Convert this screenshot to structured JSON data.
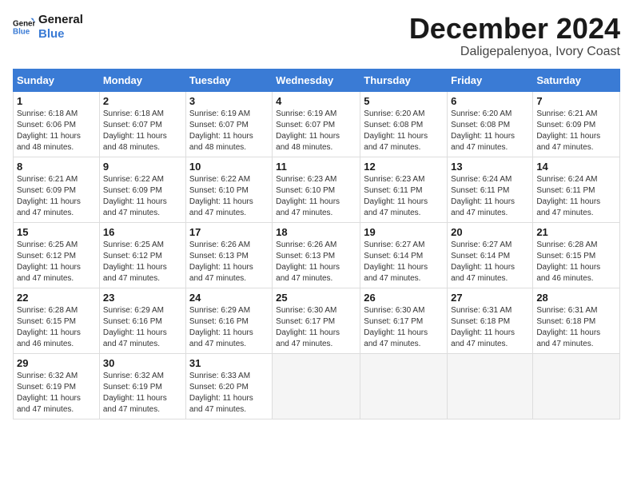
{
  "logo": {
    "line1": "General",
    "line2": "Blue"
  },
  "title": "December 2024",
  "location": "Daligepalenyoa, Ivory Coast",
  "headers": [
    "Sunday",
    "Monday",
    "Tuesday",
    "Wednesday",
    "Thursday",
    "Friday",
    "Saturday"
  ],
  "weeks": [
    [
      {
        "day": "1",
        "detail": "Sunrise: 6:18 AM\nSunset: 6:06 PM\nDaylight: 11 hours\nand 48 minutes."
      },
      {
        "day": "2",
        "detail": "Sunrise: 6:18 AM\nSunset: 6:07 PM\nDaylight: 11 hours\nand 48 minutes."
      },
      {
        "day": "3",
        "detail": "Sunrise: 6:19 AM\nSunset: 6:07 PM\nDaylight: 11 hours\nand 48 minutes."
      },
      {
        "day": "4",
        "detail": "Sunrise: 6:19 AM\nSunset: 6:07 PM\nDaylight: 11 hours\nand 48 minutes."
      },
      {
        "day": "5",
        "detail": "Sunrise: 6:20 AM\nSunset: 6:08 PM\nDaylight: 11 hours\nand 47 minutes."
      },
      {
        "day": "6",
        "detail": "Sunrise: 6:20 AM\nSunset: 6:08 PM\nDaylight: 11 hours\nand 47 minutes."
      },
      {
        "day": "7",
        "detail": "Sunrise: 6:21 AM\nSunset: 6:09 PM\nDaylight: 11 hours\nand 47 minutes."
      }
    ],
    [
      {
        "day": "8",
        "detail": "Sunrise: 6:21 AM\nSunset: 6:09 PM\nDaylight: 11 hours\nand 47 minutes."
      },
      {
        "day": "9",
        "detail": "Sunrise: 6:22 AM\nSunset: 6:09 PM\nDaylight: 11 hours\nand 47 minutes."
      },
      {
        "day": "10",
        "detail": "Sunrise: 6:22 AM\nSunset: 6:10 PM\nDaylight: 11 hours\nand 47 minutes."
      },
      {
        "day": "11",
        "detail": "Sunrise: 6:23 AM\nSunset: 6:10 PM\nDaylight: 11 hours\nand 47 minutes."
      },
      {
        "day": "12",
        "detail": "Sunrise: 6:23 AM\nSunset: 6:11 PM\nDaylight: 11 hours\nand 47 minutes."
      },
      {
        "day": "13",
        "detail": "Sunrise: 6:24 AM\nSunset: 6:11 PM\nDaylight: 11 hours\nand 47 minutes."
      },
      {
        "day": "14",
        "detail": "Sunrise: 6:24 AM\nSunset: 6:11 PM\nDaylight: 11 hours\nand 47 minutes."
      }
    ],
    [
      {
        "day": "15",
        "detail": "Sunrise: 6:25 AM\nSunset: 6:12 PM\nDaylight: 11 hours\nand 47 minutes."
      },
      {
        "day": "16",
        "detail": "Sunrise: 6:25 AM\nSunset: 6:12 PM\nDaylight: 11 hours\nand 47 minutes."
      },
      {
        "day": "17",
        "detail": "Sunrise: 6:26 AM\nSunset: 6:13 PM\nDaylight: 11 hours\nand 47 minutes."
      },
      {
        "day": "18",
        "detail": "Sunrise: 6:26 AM\nSunset: 6:13 PM\nDaylight: 11 hours\nand 47 minutes."
      },
      {
        "day": "19",
        "detail": "Sunrise: 6:27 AM\nSunset: 6:14 PM\nDaylight: 11 hours\nand 47 minutes."
      },
      {
        "day": "20",
        "detail": "Sunrise: 6:27 AM\nSunset: 6:14 PM\nDaylight: 11 hours\nand 47 minutes."
      },
      {
        "day": "21",
        "detail": "Sunrise: 6:28 AM\nSunset: 6:15 PM\nDaylight: 11 hours\nand 46 minutes."
      }
    ],
    [
      {
        "day": "22",
        "detail": "Sunrise: 6:28 AM\nSunset: 6:15 PM\nDaylight: 11 hours\nand 46 minutes."
      },
      {
        "day": "23",
        "detail": "Sunrise: 6:29 AM\nSunset: 6:16 PM\nDaylight: 11 hours\nand 47 minutes."
      },
      {
        "day": "24",
        "detail": "Sunrise: 6:29 AM\nSunset: 6:16 PM\nDaylight: 11 hours\nand 47 minutes."
      },
      {
        "day": "25",
        "detail": "Sunrise: 6:30 AM\nSunset: 6:17 PM\nDaylight: 11 hours\nand 47 minutes."
      },
      {
        "day": "26",
        "detail": "Sunrise: 6:30 AM\nSunset: 6:17 PM\nDaylight: 11 hours\nand 47 minutes."
      },
      {
        "day": "27",
        "detail": "Sunrise: 6:31 AM\nSunset: 6:18 PM\nDaylight: 11 hours\nand 47 minutes."
      },
      {
        "day": "28",
        "detail": "Sunrise: 6:31 AM\nSunset: 6:18 PM\nDaylight: 11 hours\nand 47 minutes."
      }
    ],
    [
      {
        "day": "29",
        "detail": "Sunrise: 6:32 AM\nSunset: 6:19 PM\nDaylight: 11 hours\nand 47 minutes."
      },
      {
        "day": "30",
        "detail": "Sunrise: 6:32 AM\nSunset: 6:19 PM\nDaylight: 11 hours\nand 47 minutes."
      },
      {
        "day": "31",
        "detail": "Sunrise: 6:33 AM\nSunset: 6:20 PM\nDaylight: 11 hours\nand 47 minutes."
      },
      {
        "day": "",
        "detail": ""
      },
      {
        "day": "",
        "detail": ""
      },
      {
        "day": "",
        "detail": ""
      },
      {
        "day": "",
        "detail": ""
      }
    ]
  ]
}
